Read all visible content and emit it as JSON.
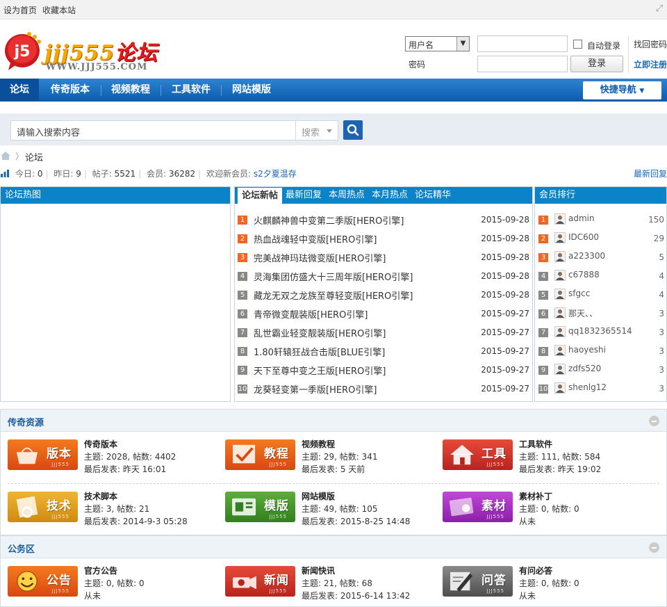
{
  "topbar": {
    "set_home": "设为首页",
    "bookmark": "收藏本站"
  },
  "logo": {
    "badge": "j5",
    "text": "jjj555",
    "cn": "论坛",
    "url": "WWW.JJJ555.COM"
  },
  "login": {
    "select_value": "用户名",
    "password_label": "密码",
    "auto_login": "自动登录",
    "login_button": "登录",
    "forgot": "找回密码",
    "register": "立即注册"
  },
  "nav": {
    "items": [
      "论坛",
      "传奇版本",
      "视频教程",
      "工具软件",
      "网站模版"
    ],
    "quick": "快捷导航"
  },
  "search": {
    "placeholder": "请输入搜索内容",
    "type": "搜索"
  },
  "breadcrumb": {
    "current": "论坛"
  },
  "stats": {
    "today_label": "今日:",
    "today": "0",
    "yesterday_label": "昨日:",
    "yesterday": "9",
    "posts_label": "帖子:",
    "posts": "5521",
    "members_label": "会员:",
    "members": "36282",
    "welcome_label": "欢迎新会员:",
    "newest": "s2夕夏温存",
    "latest_replies": "最新回复"
  },
  "hot_pic": {
    "title": "论坛热图"
  },
  "threads": {
    "tabs": [
      "论坛新帖",
      "最新回复",
      "本周热点",
      "本月热点",
      "论坛精华"
    ],
    "items": [
      {
        "n": "1",
        "title": "火麒麟神兽中变第二季版[HERO引擎]",
        "date": "2015-09-28"
      },
      {
        "n": "2",
        "title": "热血战魂轻中变版[HERO引擎]",
        "date": "2015-09-28"
      },
      {
        "n": "3",
        "title": "完美战神玛珐微变版[HERO引擎]",
        "date": "2015-09-28"
      },
      {
        "n": "4",
        "title": "灵海集团仿盛大十三周年版[HERO引擎]",
        "date": "2015-09-28"
      },
      {
        "n": "5",
        "title": "藏龙无双之龙族至尊轻变版[HERO引擎]",
        "date": "2015-09-28"
      },
      {
        "n": "6",
        "title": "青帝微变靓装版[HERO引擎]",
        "date": "2015-09-27"
      },
      {
        "n": "7",
        "title": "乱世霸业轻变靓装版[HERO引擎]",
        "date": "2015-09-27"
      },
      {
        "n": "8",
        "title": "1.80轩辕狂战合击版[BLUE引擎]",
        "date": "2015-09-27"
      },
      {
        "n": "9",
        "title": "天下至尊中变之王版[HERO引擎]",
        "date": "2015-09-27"
      },
      {
        "n": "10",
        "title": "龙葵轻变第一季版[HERO引擎]",
        "date": "2015-09-27"
      }
    ]
  },
  "ranking": {
    "title": "会员排行",
    "items": [
      {
        "n": "1",
        "name": "admin",
        "count": "150"
      },
      {
        "n": "2",
        "name": "IDC600",
        "count": "29"
      },
      {
        "n": "3",
        "name": "a223300",
        "count": "5"
      },
      {
        "n": "4",
        "name": "c67888",
        "count": "4"
      },
      {
        "n": "5",
        "name": "sfgcc",
        "count": "4"
      },
      {
        "n": "6",
        "name": "那天、、",
        "count": "3"
      },
      {
        "n": "7",
        "name": "qq1832365514",
        "count": "3"
      },
      {
        "n": "8",
        "name": "haoyeshi",
        "count": "3"
      },
      {
        "n": "9",
        "name": "zdfs520",
        "count": "3"
      },
      {
        "n": "10",
        "name": "shenlg12",
        "count": "3"
      }
    ]
  },
  "cat1": {
    "title": "传奇资源",
    "forums": [
      {
        "icon": "版本",
        "icon_sub": "JJJ555",
        "name": "传奇版本",
        "stats": "主题: 2028, 帖数: 4402",
        "last": "最后发表: 昨天 16:01"
      },
      {
        "icon": "教程",
        "icon_sub": "JJJ555",
        "name": "视频教程",
        "stats": "主题: 29, 帖数: 341",
        "last": "最后发表: 5 天前"
      },
      {
        "icon": "工具",
        "icon_sub": "JJJ555",
        "name": "工具软件",
        "stats": "主题: 111, 帖数: 584",
        "last": "最后发表: 昨天 19:02"
      },
      {
        "icon": "技术",
        "icon_sub": "JJJ555",
        "name": "技术脚本",
        "stats": "主题: 3, 帖数: 21",
        "last": "最后发表: 2014-9-3 05:28"
      },
      {
        "icon": "模版",
        "icon_sub": "JJJ555",
        "name": "网站模版",
        "stats": "主题: 49, 帖数: 105",
        "last": "最后发表: 2015-8-25 14:48"
      },
      {
        "icon": "素材",
        "icon_sub": "JJJ555",
        "name": "素材补丁",
        "stats": "主题: 0, 帖数: 0",
        "last": "从未"
      }
    ]
  },
  "cat2": {
    "title": "公务区",
    "forums": [
      {
        "icon": "公告",
        "icon_sub": "JJJ555",
        "name": "官方公告",
        "stats": "主题: 0, 帖数: 0",
        "last": "从未"
      },
      {
        "icon": "新闻",
        "icon_sub": "JJJ555",
        "name": "新闻快讯",
        "stats": "主题: 21, 帖数: 68",
        "last": "最后发表: 2015-6-14 13:42"
      },
      {
        "icon": "问答",
        "icon_sub": "JJJ555",
        "name": "有问必答",
        "stats": "主题: 0, 帖数: 0",
        "last": "从未"
      }
    ]
  },
  "colors": {
    "nav_blue": "#0b5eb0",
    "panel_head": "#0a83c9",
    "hot_num": "#f26522",
    "link": "#1b69b6"
  }
}
